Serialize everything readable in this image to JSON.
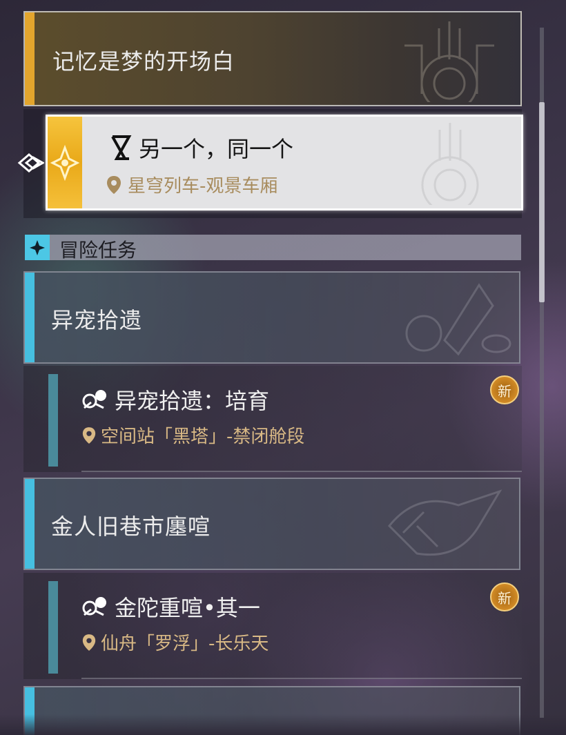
{
  "main_quest": {
    "title": "记忆是梦的开场白",
    "accent_color": "#e3a52d"
  },
  "selected_quest": {
    "title": "另一个，同一个",
    "location": "星穹列车-观景车厢",
    "icon": "hourglass-icon"
  },
  "section": {
    "title": "冒险任务",
    "icon": "four-point-star-icon",
    "accent_color": "#4cc7e5"
  },
  "categories": [
    {
      "title": "异宠拾遗",
      "missions": [
        {
          "title": "异宠拾遗：培育",
          "location": "空间站「黑塔」-禁闭舱段",
          "badge": "新",
          "icon": "adventure-icon"
        }
      ]
    },
    {
      "title": "金人旧巷市廛喧",
      "missions": [
        {
          "title": "金陀重喧•其一",
          "location": "仙舟「罗浮」-长乐天",
          "badge": "新",
          "icon": "adventure-icon"
        }
      ]
    }
  ]
}
